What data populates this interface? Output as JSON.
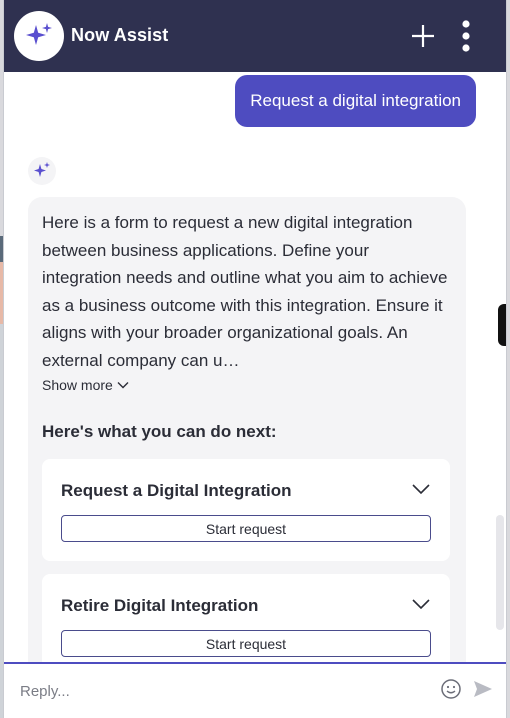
{
  "header": {
    "title": "Now Assist",
    "icons": {
      "logo": "sparkle-icon",
      "new_chat": "plus-icon",
      "menu": "more-vertical-icon"
    }
  },
  "conversation": {
    "user_message": "Request a digital integration",
    "assistant": {
      "avatar_icon": "sparkle-icon",
      "text": "Here is a form to request a new digital integration between business applications. Define your integration needs and outline what you aim to achieve as a business outcome with this integration. Ensure it aligns with your broader organizational goals. An external company can u…",
      "show_more_label": "Show more",
      "next_heading": "Here's what you can do next:",
      "options": [
        {
          "title": "Request a Digital Integration",
          "button_label": "Start request"
        },
        {
          "title": "Retire Digital Integration",
          "button_label": "Start request"
        }
      ]
    }
  },
  "composer": {
    "placeholder": "Reply...",
    "icons": {
      "emoji": "emoji-icon",
      "send": "send-icon"
    }
  },
  "colors": {
    "header_bg": "#2f3150",
    "accent": "#4e4cc0",
    "bubble_bg": "#f4f4f6",
    "button_border": "#4a4c8c"
  }
}
